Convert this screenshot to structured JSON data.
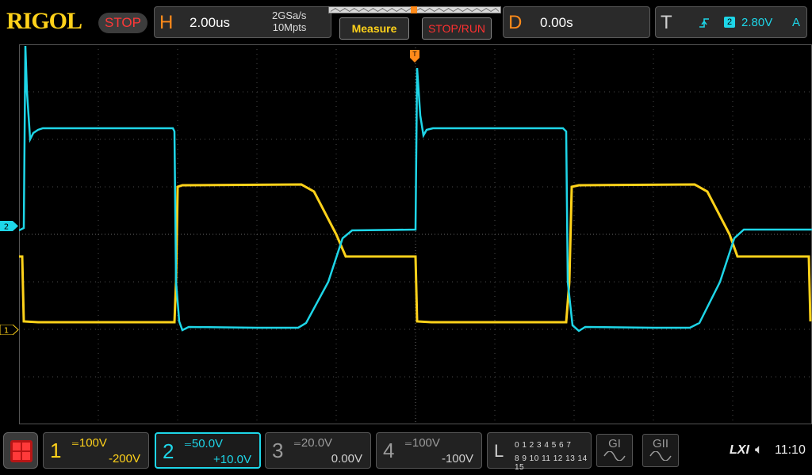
{
  "brand": "RIGOL",
  "run_state": "STOP",
  "horizontal": {
    "letter": "H",
    "timebase": "2.00us",
    "sample_rate": "2GSa/s",
    "memory_depth": "10Mpts"
  },
  "buttons": {
    "measure": "Measure",
    "stop_run": "STOP/RUN"
  },
  "delay": {
    "letter": "D",
    "value": "0.00s"
  },
  "trigger": {
    "letter": "T",
    "slope_icon": "rising-edge-icon",
    "source": "2",
    "level": "2.80V",
    "mode": "A"
  },
  "markers": {
    "ch2": "2",
    "ch1": "1"
  },
  "channels": [
    {
      "num": "1",
      "scale": "100V",
      "offset": "-200V",
      "color": "#ffd21a"
    },
    {
      "num": "2",
      "scale": "50.0V",
      "offset": "+10.0V",
      "color": "#1ed6e8"
    },
    {
      "num": "3",
      "scale": "20.0V",
      "offset": "0.00V",
      "color": "#9a9a9a"
    },
    {
      "num": "4",
      "scale": "100V",
      "offset": "-100V",
      "color": "#9a9a9a"
    }
  ],
  "logic": {
    "letter": "L",
    "row1": "0 1 2 3  4 5 6 7",
    "row2": "8 9 10 11 12 13 14 15"
  },
  "generators": {
    "g1": "GI",
    "g2": "GII"
  },
  "status": {
    "lxi": "LXI",
    "time": "11:10"
  },
  "colors": {
    "ch1": "#ffd21a",
    "ch2": "#1ed6e8",
    "accent": "#ff8a1a",
    "stop": "#ff3838"
  }
}
